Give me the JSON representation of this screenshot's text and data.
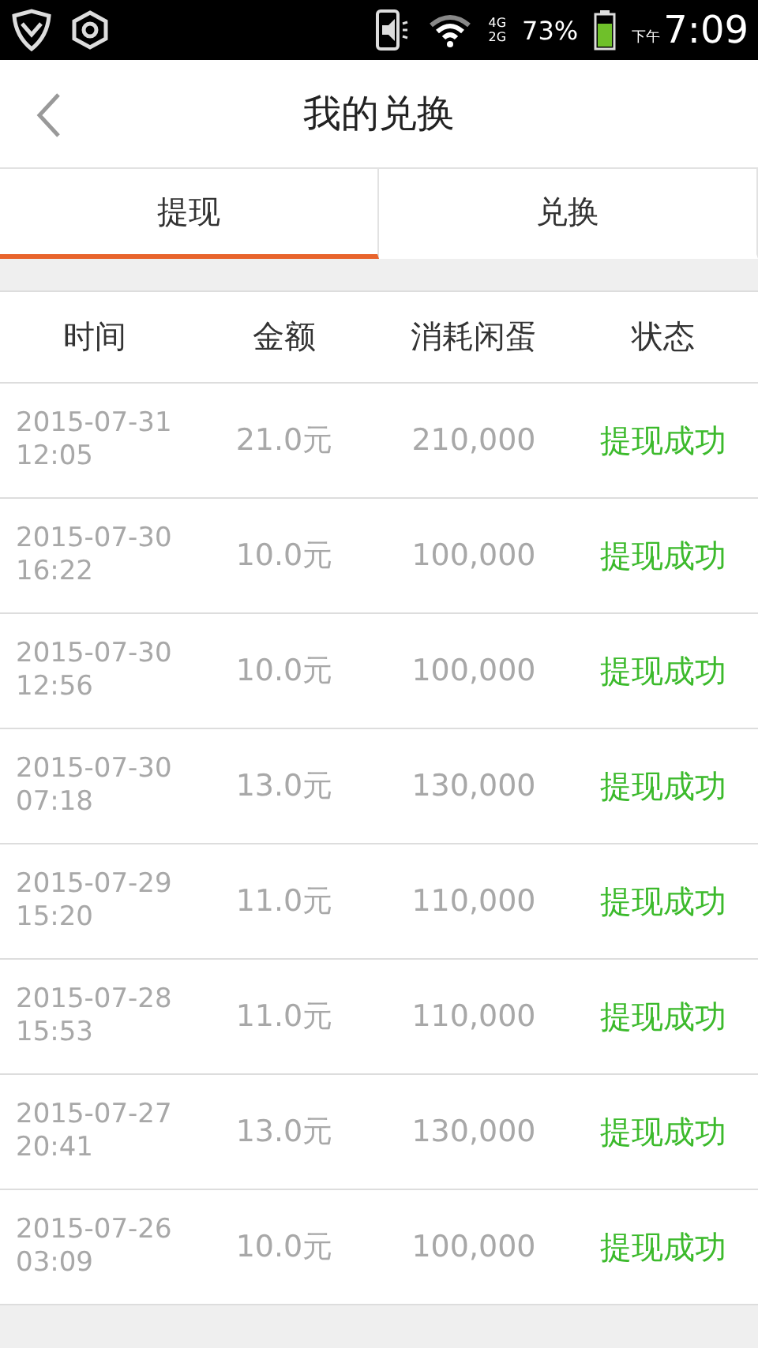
{
  "status_bar": {
    "network_top": "4G",
    "network_bottom": "2G",
    "battery": "73%",
    "period": "下午",
    "time": "7:09"
  },
  "header": {
    "title": "我的兑换"
  },
  "tabs": [
    {
      "label": "提现",
      "selected": true
    },
    {
      "label": "兑换",
      "selected": false
    }
  ],
  "table": {
    "columns": [
      "时间",
      "金额",
      "消耗闲蛋",
      "状态"
    ],
    "rows": [
      {
        "date": "2015-07-31",
        "time": "12:05",
        "amount": "21.0元",
        "eggs": "210,000",
        "status": "提现成功"
      },
      {
        "date": "2015-07-30",
        "time": "16:22",
        "amount": "10.0元",
        "eggs": "100,000",
        "status": "提现成功"
      },
      {
        "date": "2015-07-30",
        "time": "12:56",
        "amount": "10.0元",
        "eggs": "100,000",
        "status": "提现成功"
      },
      {
        "date": "2015-07-30",
        "time": "07:18",
        "amount": "13.0元",
        "eggs": "130,000",
        "status": "提现成功"
      },
      {
        "date": "2015-07-29",
        "time": "15:20",
        "amount": "11.0元",
        "eggs": "110,000",
        "status": "提现成功"
      },
      {
        "date": "2015-07-28",
        "time": "15:53",
        "amount": "11.0元",
        "eggs": "110,000",
        "status": "提现成功"
      },
      {
        "date": "2015-07-27",
        "time": "20:41",
        "amount": "13.0元",
        "eggs": "130,000",
        "status": "提现成功"
      },
      {
        "date": "2015-07-26",
        "time": "03:09",
        "amount": "10.0元",
        "eggs": "100,000",
        "status": "提现成功"
      }
    ]
  }
}
